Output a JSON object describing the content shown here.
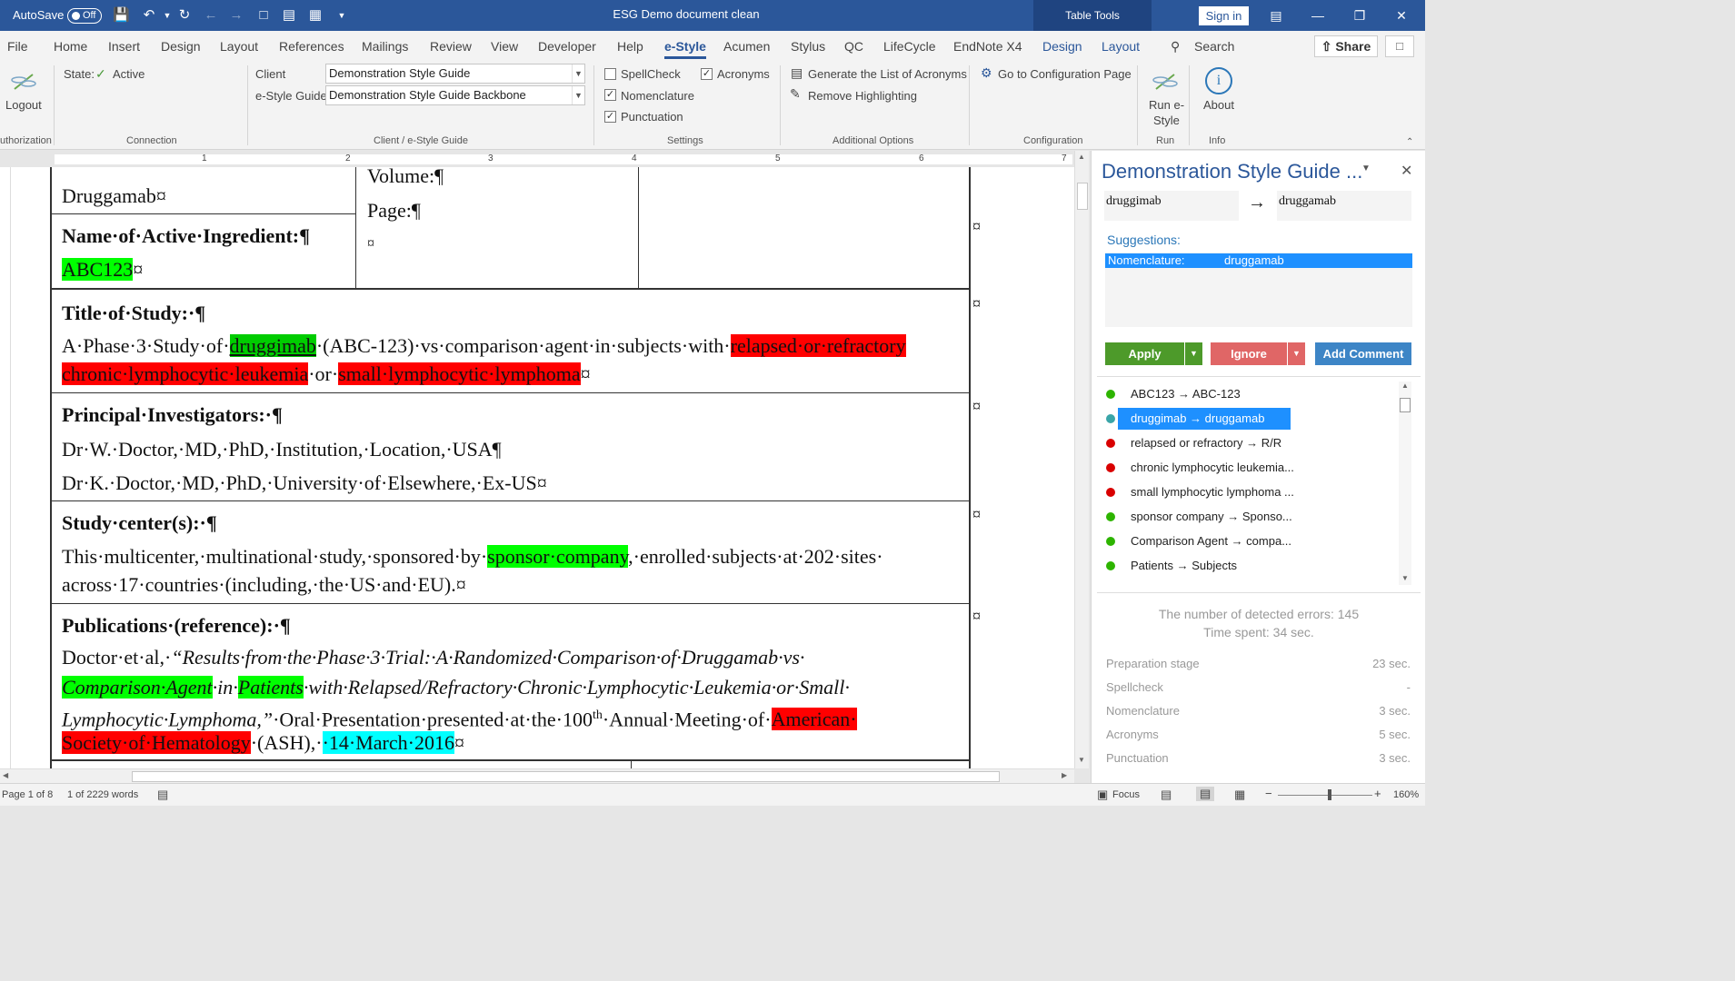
{
  "titlebar": {
    "autosave_label": "AutoSave",
    "autosave_state": "Off",
    "document_title": "ESG Demo document clean",
    "context_tab": "Table Tools",
    "signin": "Sign in"
  },
  "menu": {
    "items": [
      "File",
      "Home",
      "Insert",
      "Design",
      "Layout",
      "References",
      "Mailings",
      "Review",
      "View",
      "Developer",
      "Help",
      "e-Style",
      "Acumen",
      "Stylus",
      "QC",
      "LifeCycle",
      "EndNote X4",
      "Design",
      "Layout"
    ],
    "active": "e-Style",
    "search": "Search",
    "share": "Share"
  },
  "ribbon": {
    "logout": "Logout",
    "authorization": "uthorization",
    "state_label": "State:",
    "state_value": "Active",
    "connection": "Connection",
    "client_label": "Client",
    "client_value": "Demonstration Style Guide",
    "guide_label": "e-Style Guide",
    "guide_value": "Demonstration Style Guide Backbone",
    "client_group": "Client / e-Style Guide",
    "spellcheck": "SpellCheck",
    "acronyms": "Acronyms",
    "nomenclature": "Nomenclature",
    "punctuation": "Punctuation",
    "settings": "Settings",
    "generate_list": "Generate the List of Acronyms",
    "remove_highlighting": "Remove Highlighting",
    "additional_options": "Additional Options",
    "go_config": "Go to Configuration Page",
    "configuration": "Configuration",
    "run_estyle_1": "Run e-",
    "run_estyle_2": "Style",
    "run": "Run",
    "about": "About",
    "info": "Info"
  },
  "document": {
    "drug_cell": "Druggamab¤",
    "volume": "Volume:¶",
    "page": "Page:¶",
    "empty_cell": "¤",
    "active_ingredient_label": "Name·of·Active·Ingredient:¶",
    "active_ingredient_value": "ABC123",
    "title_label": "Title·of·Study:·¶",
    "title_l1_a": "A·Phase·3·Study·of·",
    "title_l1_drug": "druggimab",
    "title_l1_b": "·(ABC-123)·vs·comparison·agent·in·subjects·with·",
    "title_l1_rr": "relapsed·or·refractory",
    "title_l2_cll": "chronic·lymphocytic·leukemia",
    "title_l2_or": "·or·",
    "title_l2_sll": "small·lymphocytic·lymphoma",
    "pi_label": "Principal·Investigators:·¶",
    "pi_1": "Dr·W.·Doctor,·MD,·PhD,·Institution,·Location,·USA¶",
    "pi_2": "Dr·K.·Doctor,·MD,·PhD,·University·of·Elsewhere,·Ex-US¤",
    "center_label": "Study·center(s):·¶",
    "center_l1_a": "This·multicenter,·multinational·study,·sponsored·by·",
    "center_l1_sponsor": "sponsor·company",
    "center_l1_b": ",·enrolled·subjects·at·202·sites·",
    "center_l2": "across·17·countries·(including,·the·US·and·EU).¤",
    "pub_label": "Publications·(reference):·¶",
    "pub_l1_a": "Doctor·et·al,·",
    "pub_l1_b": "“Results·from·the·Phase·3·Trial:·A·Randomized·Comparison·of·Druggamab·vs·",
    "pub_l2_ca": "Comparison·Agent",
    "pub_l2_in": "·in·",
    "pub_l2_pat": "Patients",
    "pub_l2_rest": "·with·Relapsed/Refractory·Chronic·Lymphocytic·Leukemia·or·Small·",
    "pub_l3_a": "Lymphocytic·Lymphoma,”",
    "pub_l3_b": "·Oral·Presentation·presented·at·the·100",
    "pub_l3_sup": "th",
    "pub_l3_c": "·Annual·Meeting·of·",
    "pub_l3_am": "American·",
    "pub_l4_soc": "Society·of·Hematology",
    "pub_l4_ash": "·(ASH),·",
    "pub_l4_date": "·14·March·2016",
    "cell_end": "¤",
    "row_end": "¤"
  },
  "pane": {
    "title": "Demonstration Style Guide ...",
    "from_term": "druggimab",
    "to_term": "druggamab",
    "suggestions_label": "Suggestions:",
    "suggestion_type": "Nomenclature:",
    "suggestion_value": "druggamab",
    "apply": "Apply",
    "ignore": "Ignore",
    "add_comment": "Add Comment",
    "errors": [
      {
        "label": "ABC123 → ABC-123",
        "status": "green"
      },
      {
        "label": "druggimab → druggamab",
        "status": "teal"
      },
      {
        "label": "relapsed or refractory → R/R",
        "status": "red"
      },
      {
        "label": "chronic lymphocytic leukemia...",
        "status": "red"
      },
      {
        "label": "small lymphocytic lymphoma ...",
        "status": "red"
      },
      {
        "label": "sponsor company → Sponso...",
        "status": "green"
      },
      {
        "label": "Comparison Agent → compa...",
        "status": "green"
      },
      {
        "label": "Patients → Subjects",
        "status": "green"
      }
    ],
    "detected_errors": "The number of detected errors: 145",
    "time_spent": "Time spent: 34 sec.",
    "stats": [
      {
        "label": "Preparation stage",
        "value": "23 sec."
      },
      {
        "label": "Spellcheck",
        "value": "-"
      },
      {
        "label": "Nomenclature",
        "value": "3 sec."
      },
      {
        "label": "Acronyms",
        "value": "5 sec."
      },
      {
        "label": "Punctuation",
        "value": "3 sec."
      }
    ]
  },
  "status": {
    "page": "Page 1 of 8",
    "words": "1 of 2229 words",
    "focus": "Focus",
    "zoom": "160%"
  },
  "ruler_numbers": [
    "1",
    "2",
    "3",
    "4",
    "5",
    "6",
    "7"
  ],
  "colors": {
    "accent": "#2b579a",
    "highlight_green": "#00ff00",
    "highlight_red": "#ff0000",
    "highlight_cyan": "#00ffff",
    "apply_btn": "#4d9a2a",
    "ignore_btn": "#e06666",
    "comment_btn": "#3d85c6"
  }
}
